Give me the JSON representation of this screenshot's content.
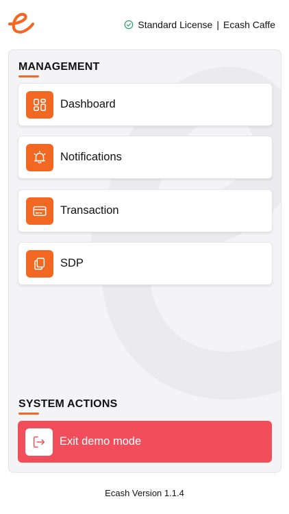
{
  "header": {
    "logo_icon": "ecash-logo-icon",
    "license_icon": "check-circle-icon",
    "license_type": "Standard License",
    "separator": "|",
    "store_name": "Ecash Caffe"
  },
  "management": {
    "title": "MANAGEMENT",
    "items": [
      {
        "label": "Dashboard",
        "icon": "dashboard-grid-icon"
      },
      {
        "label": "Notifications",
        "icon": "bell-icon"
      },
      {
        "label": "Transaction",
        "icon": "credit-card-icon"
      },
      {
        "label": "SDP",
        "icon": "copy-documents-icon"
      }
    ]
  },
  "system_actions": {
    "title": "SYSTEM ACTIONS",
    "exit_label": "Exit demo mode",
    "exit_icon": "exit-icon"
  },
  "footer": {
    "version": "Ecash Version 1.1.4"
  },
  "colors": {
    "accent": "#f26722",
    "danger": "#f24d5b",
    "license_check": "#2e9e6a",
    "panel_bg": "#f4f4f6"
  }
}
